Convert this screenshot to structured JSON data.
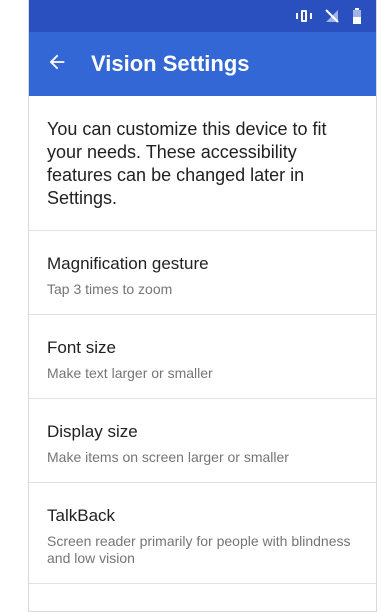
{
  "status_bar": {
    "icons": [
      "vibrate-icon",
      "no-signal-icon",
      "battery-icon"
    ]
  },
  "app_bar": {
    "back_icon": "back-arrow-icon",
    "title": "Vision Settings"
  },
  "intro": {
    "text": "You can customize this device to fit your needs. These accessibility features can be changed later in Settings."
  },
  "settings": [
    {
      "title": "Magnification gesture",
      "summary": "Tap 3 times to zoom"
    },
    {
      "title": "Font size",
      "summary": "Make text larger or smaller"
    },
    {
      "title": "Display size",
      "summary": "Make items on screen larger or smaller"
    },
    {
      "title": "TalkBack",
      "summary": "Screen reader primarily for people with blindness and low vision"
    }
  ],
  "colors": {
    "status_bar": "#2a4fbf",
    "app_bar": "#3367d6",
    "title_text": "#212121",
    "summary_text": "#757575"
  }
}
